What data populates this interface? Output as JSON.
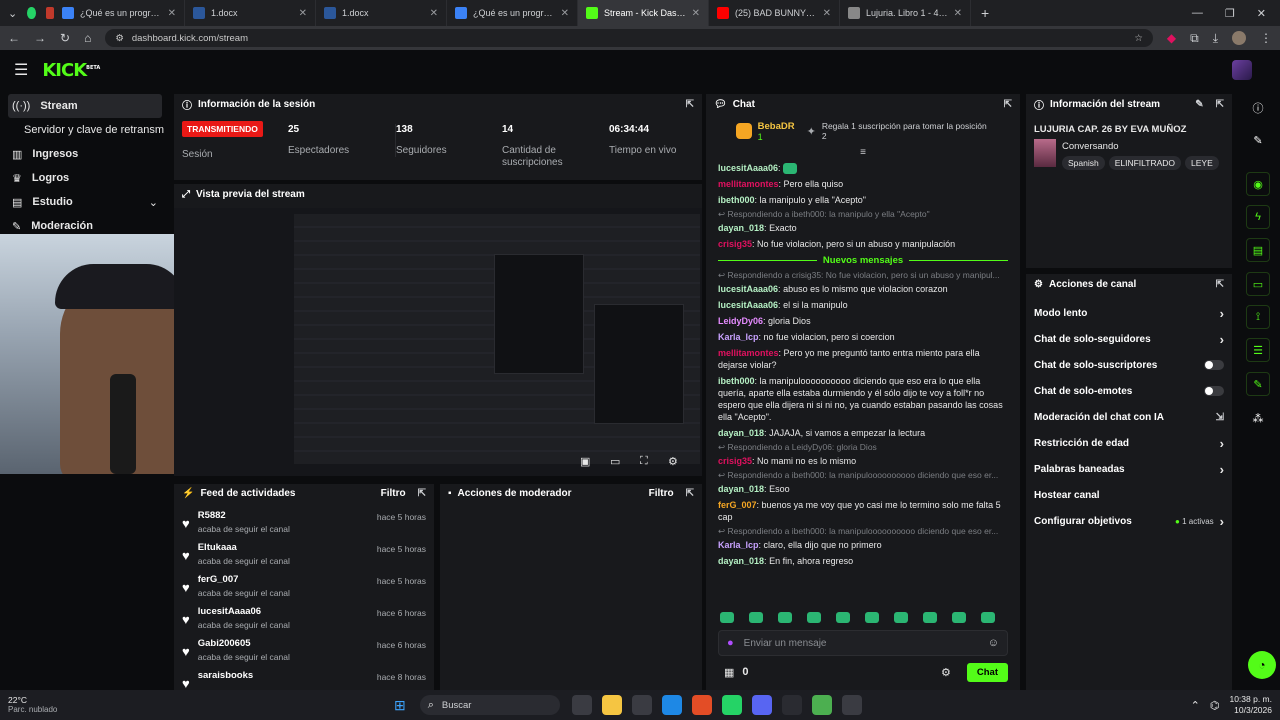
{
  "browser": {
    "tabs": [
      {
        "title": "¿Qué es un programa d",
        "color": "#3b82f6"
      },
      {
        "title": "1.docx",
        "color": "#2b579a"
      },
      {
        "title": "1.docx",
        "color": "#2b579a"
      },
      {
        "title": "¿Qué es un programa d",
        "color": "#3b82f6"
      },
      {
        "title": "Stream - Kick Dashboar",
        "color": "#53fc18",
        "active": true
      },
      {
        "title": "(25) BAD BUNNY - EL C",
        "color": "#ff0000"
      },
      {
        "title": "Lujuria. Libro 1 - 4735",
        "color": "#888888"
      }
    ],
    "url": "dashboard.kick.com/stream"
  },
  "kick": {
    "logo": "KICK",
    "logo_sup": "BETA"
  },
  "sidebar": {
    "items": [
      {
        "label": "Stream",
        "icon": "broadcast-icon"
      },
      {
        "label": "Servidor y clave de retransm",
        "icon": ""
      },
      {
        "label": "Ingresos",
        "icon": "bank-icon"
      },
      {
        "label": "Logros",
        "icon": "trophy-icon"
      },
      {
        "label": "Estudio",
        "icon": "studio-icon"
      },
      {
        "label": "Moderación",
        "icon": "wrench-icon"
      }
    ]
  },
  "session": {
    "title": "Información de la sesión",
    "live_badge": "TRANSMITIENDO",
    "session_label": "Sesión",
    "stats": [
      {
        "value": "25",
        "label": "Espectadores"
      },
      {
        "value": "138",
        "label": "Seguidores"
      },
      {
        "value": "14",
        "label": "Cantidad de suscripciones"
      },
      {
        "value": "06:34:44",
        "label": "Tiempo en vivo"
      }
    ]
  },
  "preview": {
    "title": "Vista previa del stream"
  },
  "feed": {
    "title": "Feed de actividades",
    "filter": "Filtro",
    "items": [
      {
        "name": "R5882",
        "action": "acaba de seguir el canal",
        "time": "hace 5 horas"
      },
      {
        "name": "Eltukaaa",
        "action": "acaba de seguir el canal",
        "time": "hace 5 horas"
      },
      {
        "name": "ferG_007",
        "action": "acaba de seguir el canal",
        "time": "hace 5 horas"
      },
      {
        "name": "lucesitAaaa06",
        "action": "acaba de seguir el canal",
        "time": "hace 6 horas"
      },
      {
        "name": "Gabi200605",
        "action": "acaba de seguir el canal",
        "time": "hace 6 horas"
      },
      {
        "name": "saraisbooks",
        "action": "",
        "time": "hace 8 horas"
      }
    ]
  },
  "modactions": {
    "title": "Acciones de moderador",
    "filter": "Filtro"
  },
  "chat": {
    "title": "Chat",
    "pinned_user": "BebaDR",
    "pinned_count": "1",
    "pinned_text": "Regala 1 suscripción para tomar la posición 2",
    "new_messages": "Nuevos mensajes",
    "messages": [
      {
        "user": "lucesitAaaa06",
        "color": "#b5f0c4",
        "text": ""
      },
      {
        "user": "mellitamontes",
        "color": "#e0115f",
        "text": "Pero ella quiso"
      },
      {
        "user": "ibeth000",
        "color": "#b5f0c4",
        "text": "la manipulo y ella \"Acepto\""
      },
      {
        "reply": "Respondiendo a ibeth000: la manipulo y ella \"Acepto\""
      },
      {
        "user": "dayan_018",
        "color": "#b5f0c4",
        "text": "Exacto"
      },
      {
        "user": "crisig35",
        "color": "#e0115f",
        "text": "No fue violacion, pero si un abuso y manipulación"
      },
      {
        "divider": true
      },
      {
        "reply": "Respondiendo a crisig35: No fue violacion, pero si un abuso y manipul..."
      },
      {
        "user": "lucesitAaaa06",
        "color": "#b5f0c4",
        "text": "abuso es lo mismo que violacion corazon"
      },
      {
        "user": "lucesitAaaa06",
        "color": "#b5f0c4",
        "text": "el si la manipulo"
      },
      {
        "user": "LeidyDy06",
        "color": "#e58bff",
        "text": "gloria Dios"
      },
      {
        "user": "Karla_lcp",
        "color": "#c8a2ff",
        "text": "no fue violacion, pero si coercion"
      },
      {
        "user": "mellitamontes",
        "color": "#e0115f",
        "text": "Pero yo me preguntó tanto entra miento para ella dejarse violar?"
      },
      {
        "user": "ibeth000",
        "color": "#b5f0c4",
        "text": "la manipuloooooooooo diciendo que eso era lo que ella quería, aparte ella estaba durmiendo y él sólo dijo te voy a foll*r no espero que ella dijera ni si ni no, ya cuando estaban pasando las cosas ella \"Acepto\"."
      },
      {
        "user": "dayan_018",
        "color": "#b5f0c4",
        "text": "JAJAJA, si vamos a empezar la lectura"
      },
      {
        "reply": "Respondiendo a LeidyDy06: gloria Dios"
      },
      {
        "user": "crisig35",
        "color": "#e0115f",
        "text": "No mami no es lo mismo"
      },
      {
        "reply": "Respondiendo a ibeth000: la manipuloooooooooo diciendo que eso er..."
      },
      {
        "user": "dayan_018",
        "color": "#b5f0c4",
        "text": "Esoo"
      },
      {
        "user": "ferG_007",
        "color": "#f5a623",
        "text": "buenos ya me voy que yo casi me lo termino solo me falta 5 cap"
      },
      {
        "reply": "Respondiendo a ibeth000: la manipuloooooooooo diciendo que eso er..."
      },
      {
        "user": "Karla_lcp",
        "color": "#c8a2ff",
        "text": "claro, ella dijo que no primero"
      },
      {
        "user": "dayan_018",
        "color": "#b5f0c4",
        "text": "En fin, ahora regreso"
      }
    ],
    "input_placeholder": "Enviar un mensaje",
    "points": "0",
    "send_label": "Chat"
  },
  "streaminfo": {
    "title": "Información del stream",
    "stream_title": "LUJURIA CAP. 26 BY EVA MUÑOZ",
    "category": "Conversando",
    "tags": [
      "Spanish",
      "ELINFILTRADO",
      "LEYE"
    ]
  },
  "channel": {
    "title": "Acciones de canal",
    "items": [
      {
        "label": "Modo lento",
        "ctrl": "chevron"
      },
      {
        "label": "Chat de solo-seguidores",
        "ctrl": "chevron"
      },
      {
        "label": "Chat de solo-suscriptores",
        "ctrl": "toggle"
      },
      {
        "label": "Chat de solo-emotes",
        "ctrl": "toggle"
      },
      {
        "label": "Moderación del chat con IA",
        "ctrl": "ext"
      },
      {
        "label": "Restricción de edad",
        "ctrl": "chevron"
      },
      {
        "label": "Palabras baneadas",
        "ctrl": "chevron"
      },
      {
        "label": "Hostear canal",
        "ctrl": "none"
      },
      {
        "label": "Configurar objetivos",
        "ctrl": "chevron",
        "extra": "1 activas"
      }
    ]
  },
  "taskbar": {
    "weather_temp": "22°C",
    "weather_desc": "Parc. nublado",
    "search": "Buscar",
    "time": "10:38 p. m.",
    "date": "10/3/2026"
  }
}
